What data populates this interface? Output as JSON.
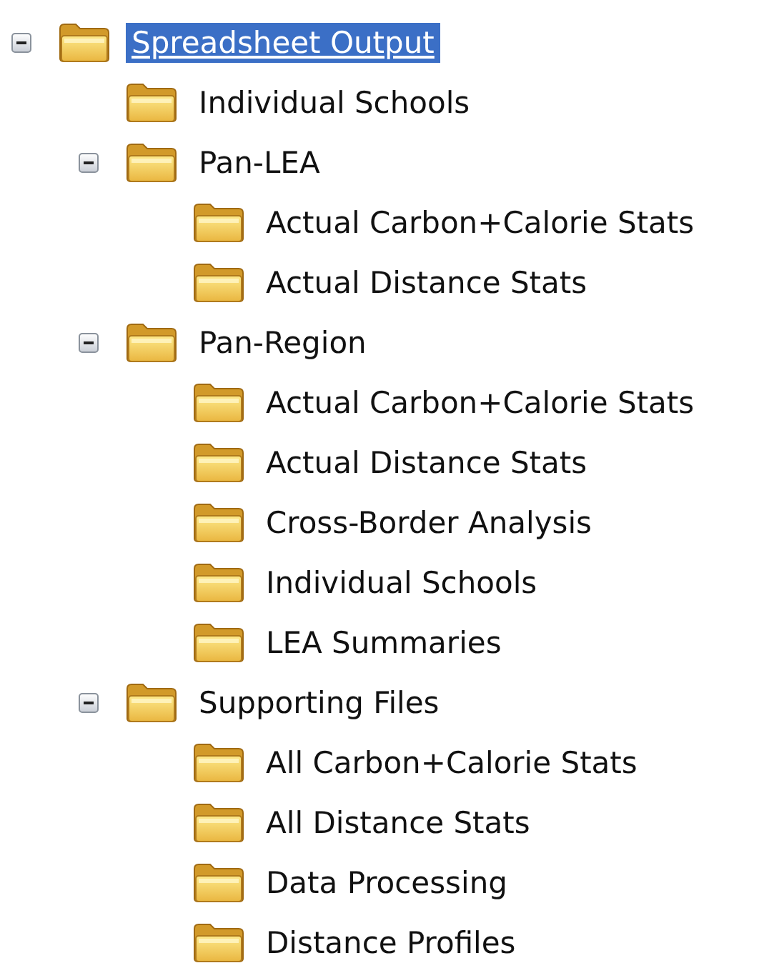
{
  "tree": [
    {
      "label": "Spreadsheet Output",
      "selected": true,
      "expanded": true,
      "children": [
        {
          "label": "Individual Schools",
          "selected": false
        },
        {
          "label": "Pan-LEA",
          "selected": false,
          "expanded": true,
          "children": [
            {
              "label": "Actual Carbon+Calorie Stats",
              "selected": false
            },
            {
              "label": "Actual Distance Stats",
              "selected": false
            }
          ]
        },
        {
          "label": "Pan-Region",
          "selected": false,
          "expanded": true,
          "children": [
            {
              "label": "Actual Carbon+Calorie Stats",
              "selected": false
            },
            {
              "label": "Actual Distance Stats",
              "selected": false
            },
            {
              "label": "Cross-Border Analysis",
              "selected": false
            },
            {
              "label": "Individual Schools",
              "selected": false
            },
            {
              "label": "LEA Summaries",
              "selected": false
            }
          ]
        },
        {
          "label": "Supporting Files",
          "selected": false,
          "expanded": true,
          "children": [
            {
              "label": "All Carbon+Calorie Stats",
              "selected": false
            },
            {
              "label": "All Distance Stats",
              "selected": false
            },
            {
              "label": "Data Processing",
              "selected": false
            },
            {
              "label": "Distance Profiles",
              "selected": false
            }
          ]
        }
      ]
    }
  ]
}
